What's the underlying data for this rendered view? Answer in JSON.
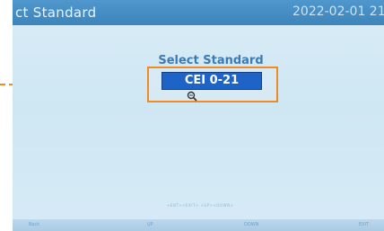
{
  "header": {
    "title": "ct Standard",
    "datetime": "2022-02-01 21"
  },
  "main": {
    "heading": "Select Standard",
    "selected_standard": "CEI 0-21",
    "hint": "<ENT><EXIT> <UP><DOWN>"
  },
  "footer": {
    "softkeys": [
      "Back",
      "UP",
      "DOWN",
      "EXIT"
    ]
  },
  "colors": {
    "title_bar": "#3d84bb",
    "screen_background": "#d9edf7",
    "selector_fill": "#1e63c6",
    "annotation_orange": "#f08a24"
  },
  "icons": {
    "magnifier": "magnifier-icon",
    "arrow": "dashed-arrow-icon"
  }
}
